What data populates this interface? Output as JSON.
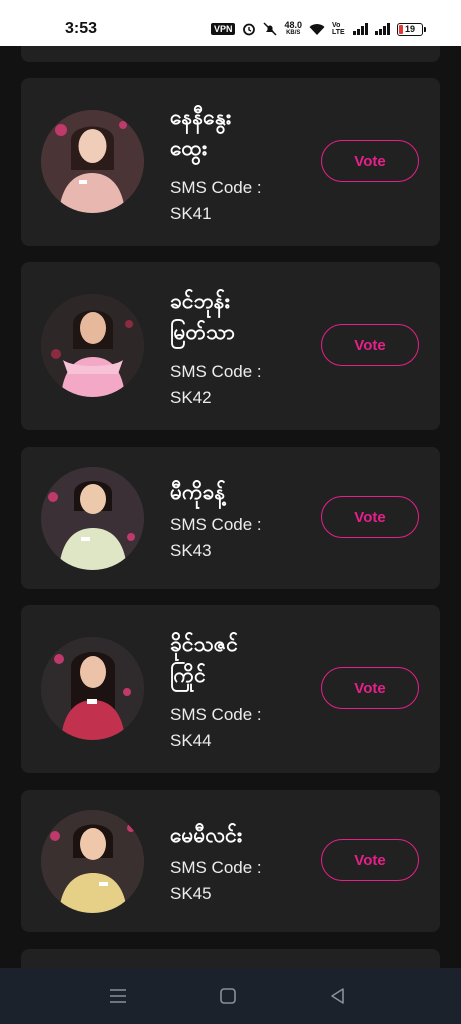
{
  "status_bar": {
    "time": "3:53",
    "vpn": "VPN",
    "speed_value": "48.0",
    "speed_unit": "KB/S",
    "volte": "Vo LTE",
    "battery": "19",
    "battery_color": "#e53935"
  },
  "accent_color": "#e6208a",
  "contestants": [
    {
      "name_line1": "နေနီနွေး",
      "name_line2": "ထွေး",
      "sms_label": "SMS Code :",
      "sms_code": "SK41",
      "vote_label": "Vote",
      "dress_color": "#e8b7b0"
    },
    {
      "name_line1": "ခင်ဘုန်း",
      "name_line2": "မြတ်သာ",
      "sms_label": "SMS Code :",
      "sms_code": "SK42",
      "vote_label": "Vote",
      "dress_color": "#f3a9c6"
    },
    {
      "name_line1": "မီကိုခန့်",
      "name_line2": "",
      "sms_label": "SMS Code :",
      "sms_code": "SK43",
      "vote_label": "Vote",
      "dress_color": "#dfe6c5"
    },
    {
      "name_line1": "ခိုင်သဇင်",
      "name_line2": "ကြိုင်",
      "sms_label": "SMS Code :",
      "sms_code": "SK44",
      "vote_label": "Vote",
      "dress_color": "#c2314d"
    },
    {
      "name_line1": "မေမီလင်း",
      "name_line2": "",
      "sms_label": "SMS Code :",
      "sms_code": "SK45",
      "vote_label": "Vote",
      "dress_color": "#e6cf86"
    }
  ]
}
